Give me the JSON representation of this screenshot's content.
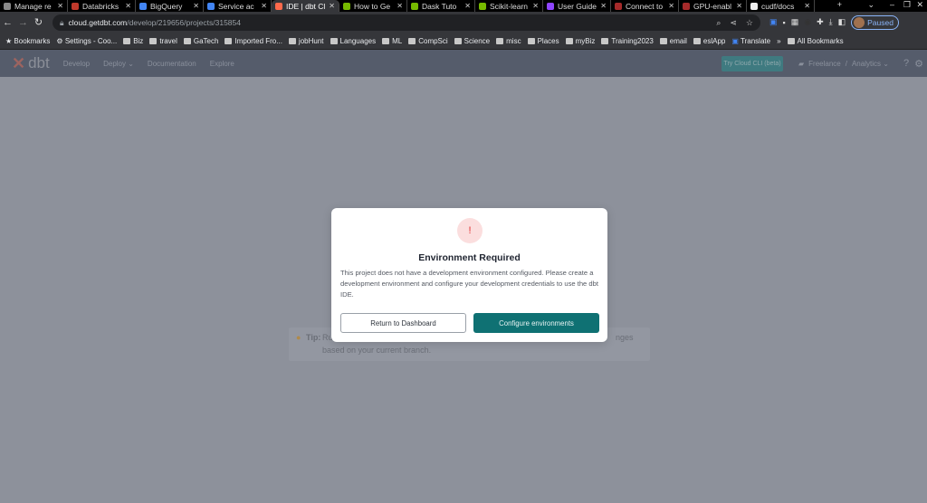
{
  "browser": {
    "tabs": [
      {
        "label": "Manage re",
        "color": "#888"
      },
      {
        "label": "Databricks",
        "color": "#c0392b"
      },
      {
        "label": "BigQuery",
        "color": "#4285f4"
      },
      {
        "label": "Service ac",
        "color": "#4285f4"
      },
      {
        "label": "IDE | dbt Cl",
        "color": "#ff694b",
        "active": true
      },
      {
        "label": "How to Ge",
        "color": "#76b900"
      },
      {
        "label": "Dask Tuto",
        "color": "#76b900"
      },
      {
        "label": "Scikit-learn",
        "color": "#76b900"
      },
      {
        "label": "User Guide",
        "color": "#8e44ff"
      },
      {
        "label": "Connect to",
        "color": "#a52a2a"
      },
      {
        "label": "GPU-enabl",
        "color": "#a52a2a"
      },
      {
        "label": "cudf/docs",
        "color": "#eee"
      }
    ],
    "url_host": "cloud.getdbt.com",
    "url_path": "/develop/219656/projects/315854",
    "profile_status": "Paused",
    "bookmarks": [
      "Bookmarks",
      "Settings - Coo...",
      "Biz",
      "travel",
      "GaTech",
      "Imported Fro...",
      "jobHunt",
      "Languages",
      "ML",
      "CompSci",
      "Science",
      "misc",
      "Places",
      "myBiz",
      "Training2023",
      "email",
      "eslApp",
      "Translate",
      "»",
      "All Bookmarks"
    ]
  },
  "app": {
    "logo": "dbt",
    "nav": [
      "Develop",
      "Deploy ⌄",
      "Documentation",
      "Explore"
    ],
    "try_cli": "Try Cloud CLI (beta)",
    "account": "Freelance",
    "separator": "/",
    "project": "Analytics ⌄"
  },
  "tip": {
    "label": "Tip:",
    "fragment_start": "Ru",
    "fragment_end": "nges",
    "line2": "based on your current branch."
  },
  "dialog": {
    "icon": "!",
    "title": "Environment Required",
    "body": "This project does not have a development environment configured. Please create a development environment and configure your development credentials to use the dbt IDE.",
    "secondary": "Return to Dashboard",
    "primary": "Configure environments"
  }
}
